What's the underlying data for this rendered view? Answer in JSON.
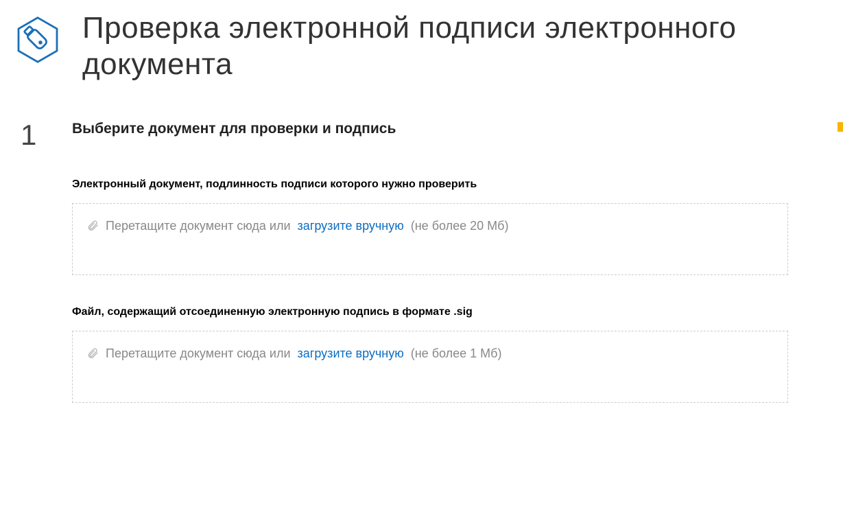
{
  "header": {
    "title": "Проверка электронной подписи электронного документа"
  },
  "step": {
    "number": "1",
    "heading": "Выберите документ для проверки и подпись"
  },
  "uploads": [
    {
      "label": "Электронный документ, подлинность подписи которого нужно проверить",
      "drop_text": "Перетащите документ сюда или",
      "link_text": "загрузите вручную",
      "size_hint": "(не более 20 Мб)"
    },
    {
      "label": "Файл, содержащий отсоединенную электронную подпись в формате .sig",
      "drop_text": "Перетащите документ сюда или",
      "link_text": "загрузите вручную",
      "size_hint": "(не более 1 Мб)"
    }
  ],
  "colors": {
    "accent_blue": "#0d6dc1",
    "icon_blue": "#1b6fb8",
    "accent_yellow": "#f7b500"
  }
}
